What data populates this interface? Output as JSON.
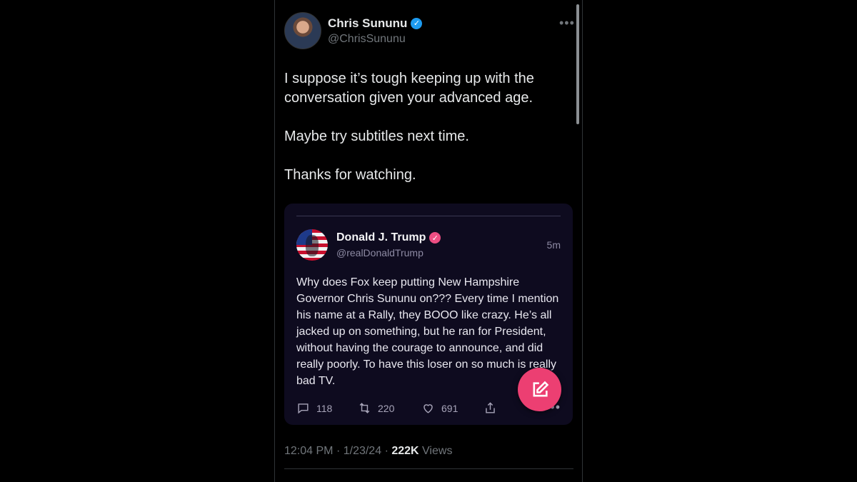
{
  "tweet": {
    "author": {
      "display_name": "Chris Sununu",
      "handle": "@ChrisSununu",
      "verified_color": "#1d9bf0"
    },
    "paragraphs": [
      "I suppose it’s tough keeping up with the conversation given your advanced age.",
      "Maybe try subtitles next time.",
      "Thanks for watching."
    ],
    "more_icon": "more-horizontal-icon",
    "meta": {
      "time": "12:04 PM",
      "date": "1/23/24",
      "views_count": "222K",
      "views_label": "Views",
      "separator": "·"
    }
  },
  "quoted_post": {
    "author": {
      "display_name": "Donald J. Trump",
      "handle": "@realDonaldTrump",
      "verified_color": "#ec4e82"
    },
    "time_ago": "5m",
    "text": "Why does Fox keep putting New Hampshire Governor Chris Sununu on??? Every time I mention his name at a Rally, they BOOO like crazy. He’s all jacked up on something, but he ran for President, without having the courage to announce, and did really poorly. To have this loser on so much is really bad TV.",
    "actions": {
      "replies": "118",
      "reposts": "220",
      "likes": "691"
    },
    "action_icons": [
      "reply-icon",
      "repost-icon",
      "like-icon",
      "share-icon",
      "more-horizontal-icon"
    ]
  },
  "compose_button": {
    "icon": "compose-icon",
    "color": "#ec3f72"
  }
}
